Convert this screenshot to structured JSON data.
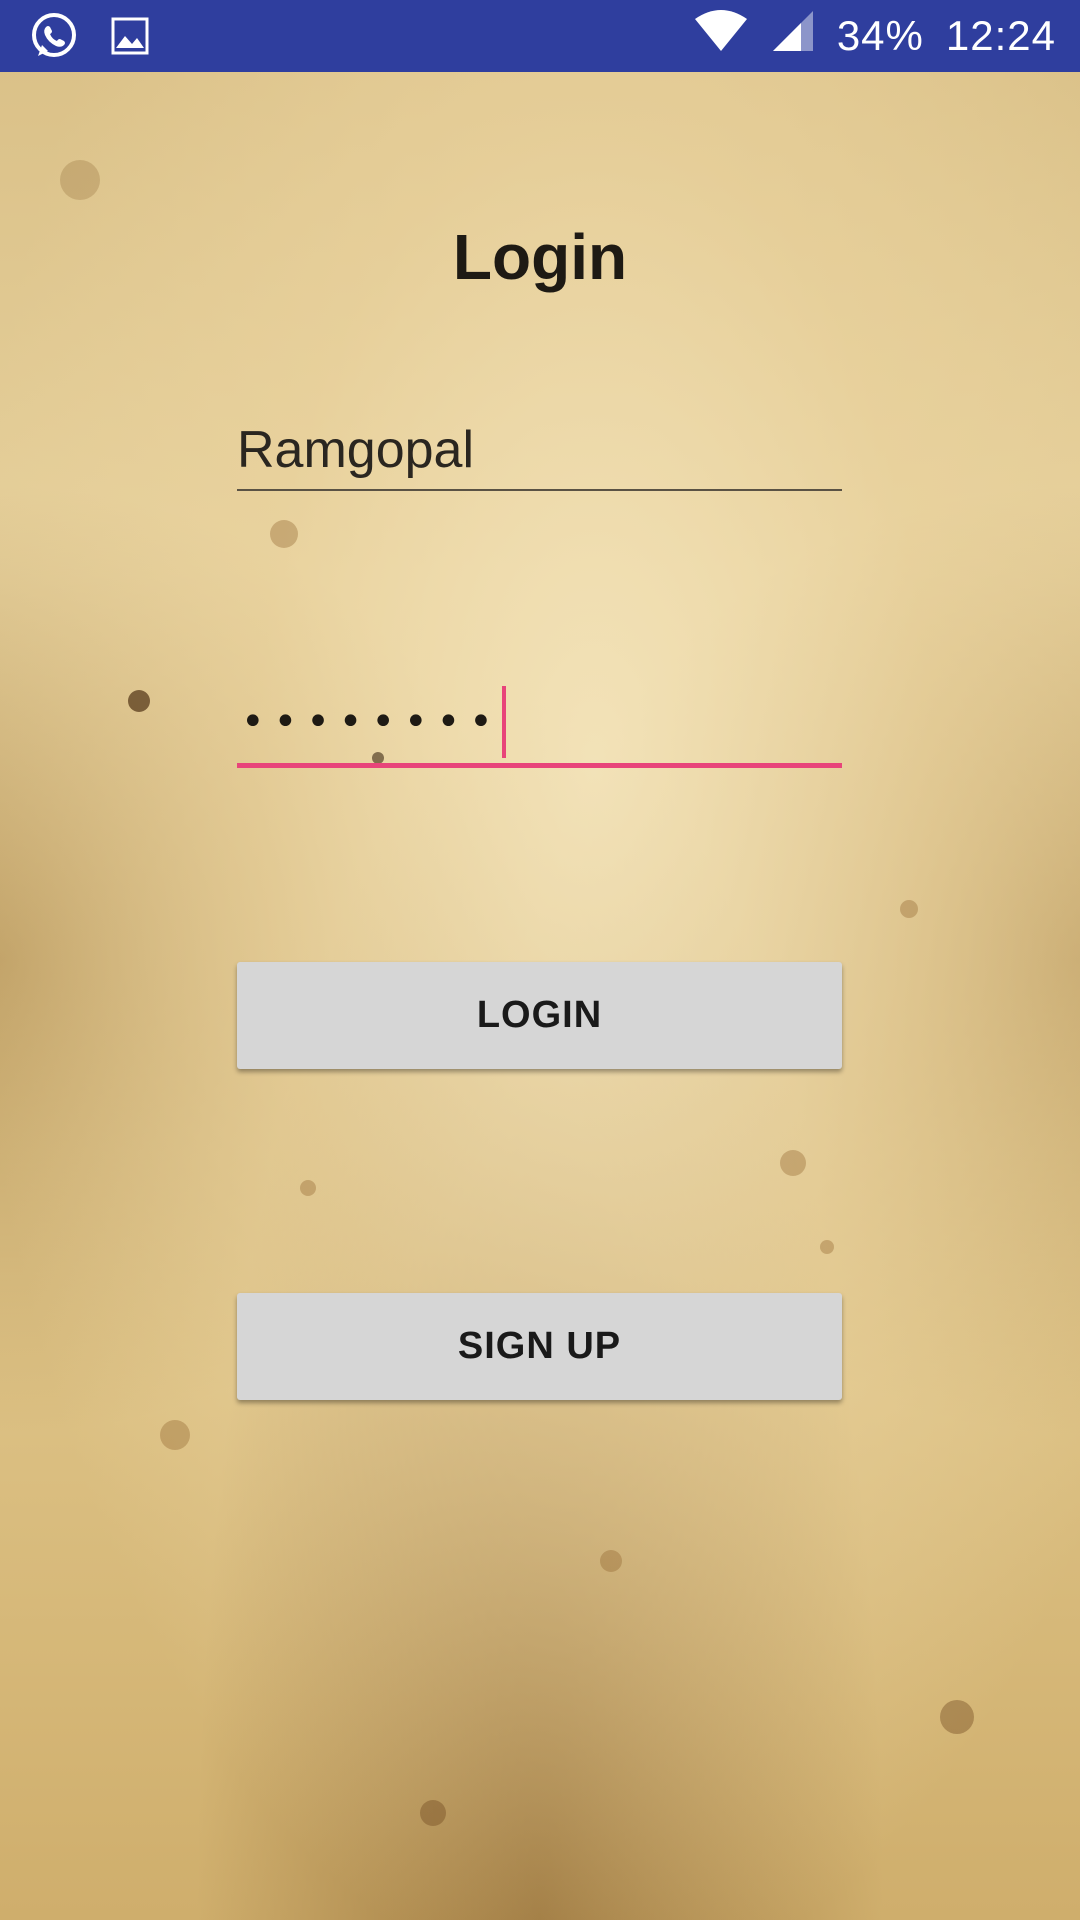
{
  "status_bar": {
    "battery": "34%",
    "time": "12:24",
    "icons": [
      "whatsapp-icon",
      "gallery-icon",
      "wifi-icon",
      "cell-signal-icon"
    ],
    "background_color": "#2f3e9e"
  },
  "login_screen": {
    "title": "Login",
    "username_value": "Ramgopal",
    "password_masked": "••••••••",
    "login_button_label": "LOGIN",
    "signup_button_label": "SIGN UP",
    "accent_color": "#e8447a"
  }
}
